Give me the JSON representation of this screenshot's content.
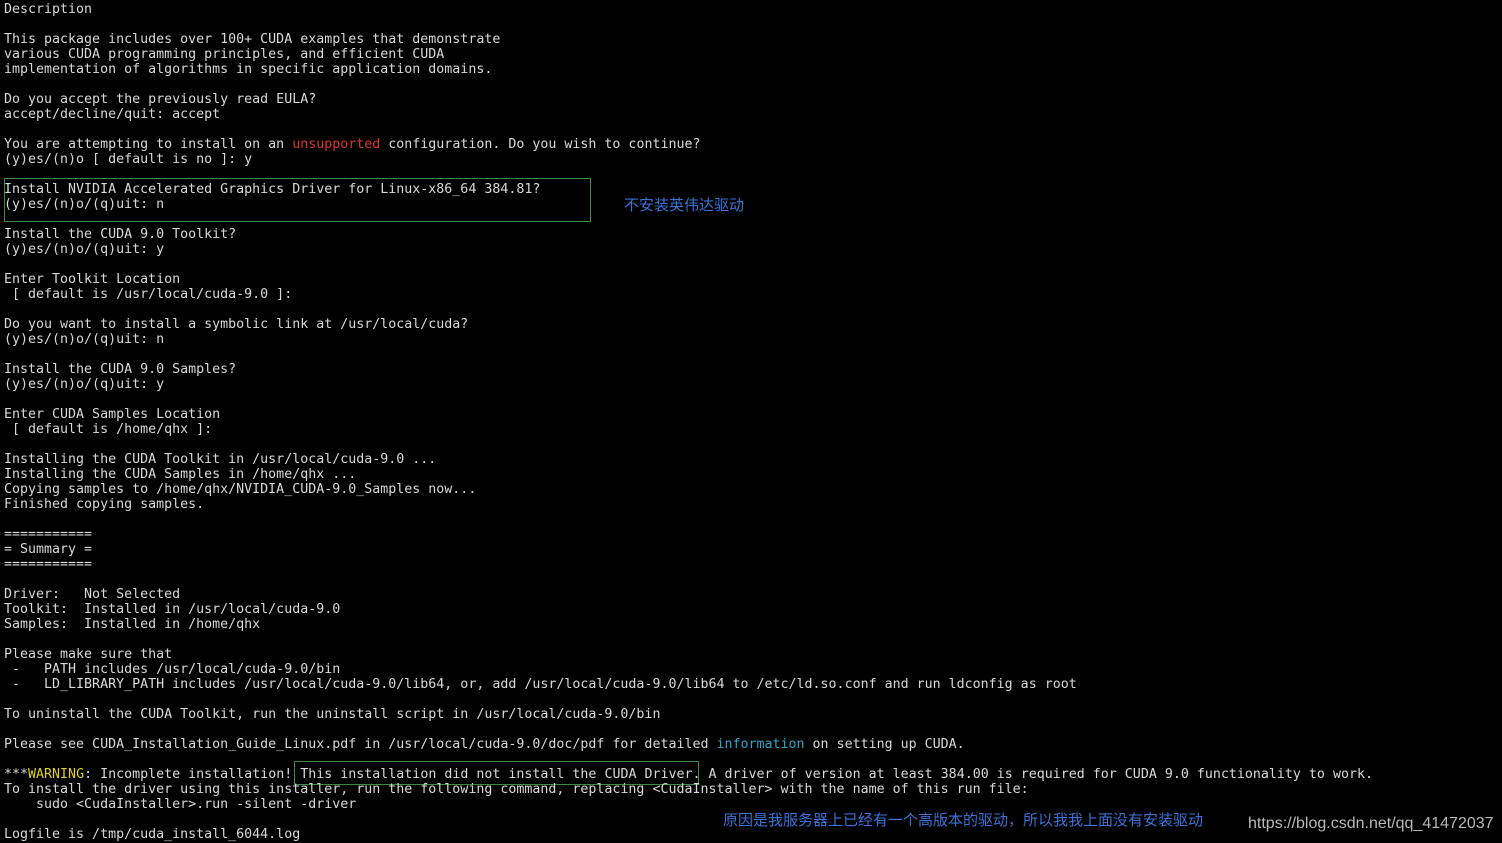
{
  "colors": {
    "background": "#000000",
    "text": "#d8d8d8",
    "unsupported": "#e03030",
    "information": "#2aa8c8",
    "warning": "#e0d020",
    "annotation": "#3a72d8",
    "highlight_border": "#3c8a3c"
  },
  "terminal": {
    "description_header": "Description",
    "pkg_line1": "This package includes over 100+ CUDA examples that demonstrate",
    "pkg_line2": "various CUDA programming principles, and efficient CUDA",
    "pkg_line3": "implementation of algorithms in specific application domains.",
    "eula_question": "Do you accept the previously read EULA?",
    "eula_answer": "accept/decline/quit: accept",
    "config_prefix": "You are attempting to install on an ",
    "config_unsupported": "unsupported",
    "config_suffix": " configuration. Do you wish to continue?",
    "config_answer": "(y)es/(n)o [ default is no ]: y",
    "driver_question": "Install NVIDIA Accelerated Graphics Driver for Linux-x86_64 384.81?",
    "driver_answer": "(y)es/(n)o/(q)uit: n",
    "toolkit_question": "Install the CUDA 9.0 Toolkit?",
    "toolkit_answer": "(y)es/(n)o/(q)uit: y",
    "toolkit_location": "Enter Toolkit Location",
    "toolkit_location_default": " [ default is /usr/local/cuda-9.0 ]:",
    "symlink_question": "Do you want to install a symbolic link at /usr/local/cuda?",
    "symlink_answer": "(y)es/(n)o/(q)uit: n",
    "samples_question": "Install the CUDA 9.0 Samples?",
    "samples_answer": "(y)es/(n)o/(q)uit: y",
    "samples_location": "Enter CUDA Samples Location",
    "samples_location_default": " [ default is /home/qhx ]:",
    "installing_toolkit": "Installing the CUDA Toolkit in /usr/local/cuda-9.0 ...",
    "installing_samples": "Installing the CUDA Samples in /home/qhx ...",
    "copying_samples": "Copying samples to /home/qhx/NVIDIA_CUDA-9.0_Samples now...",
    "finished_copying": "Finished copying samples.",
    "summary_rule": "===========",
    "summary_title": "= Summary =",
    "summary_driver": "Driver:   Not Selected",
    "summary_toolkit": "Toolkit:  Installed in /usr/local/cuda-9.0",
    "summary_samples": "Samples:  Installed in /home/qhx",
    "make_sure": "Please make sure that",
    "path_item": " -   PATH includes /usr/local/cuda-9.0/bin",
    "ld_item": " -   LD_LIBRARY_PATH includes /usr/local/cuda-9.0/lib64, or, add /usr/local/cuda-9.0/lib64 to /etc/ld.so.conf and run ldconfig as root",
    "uninstall_line": "To uninstall the CUDA Toolkit, run the uninstall script in /usr/local/cuda-9.0/bin",
    "see_prefix": "Please see CUDA_Installation_Guide_Linux.pdf in /usr/local/cuda-9.0/doc/pdf for detailed ",
    "see_information": "information",
    "see_suffix": " on setting up CUDA.",
    "warning_stars": "***",
    "warning_label": "WARNING",
    "warning_text": ": Incomplete installation! ",
    "warning_boxed": "This installation did not install the CUDA Driver.",
    "warning_rest": " A driver of version at least 384.00 is required for CUDA 9.0 functionality to work.",
    "install_driver_line": "To install the driver using this installer, run the following command, replacing <CudaInstaller> with the name of this run file:",
    "sudo_command": "    sudo <CudaInstaller>.run -silent -driver",
    "logfile_line": "Logfile is /tmp/cuda_install_6044.log"
  },
  "annotations": {
    "no_driver_note": "不安装英伟达驱动",
    "reason_note": "原因是我服务器上已经有一个高版本的驱动，所以我我上面没有安装驱动",
    "watermark": "https://blog.csdn.net/qq_41472037"
  }
}
